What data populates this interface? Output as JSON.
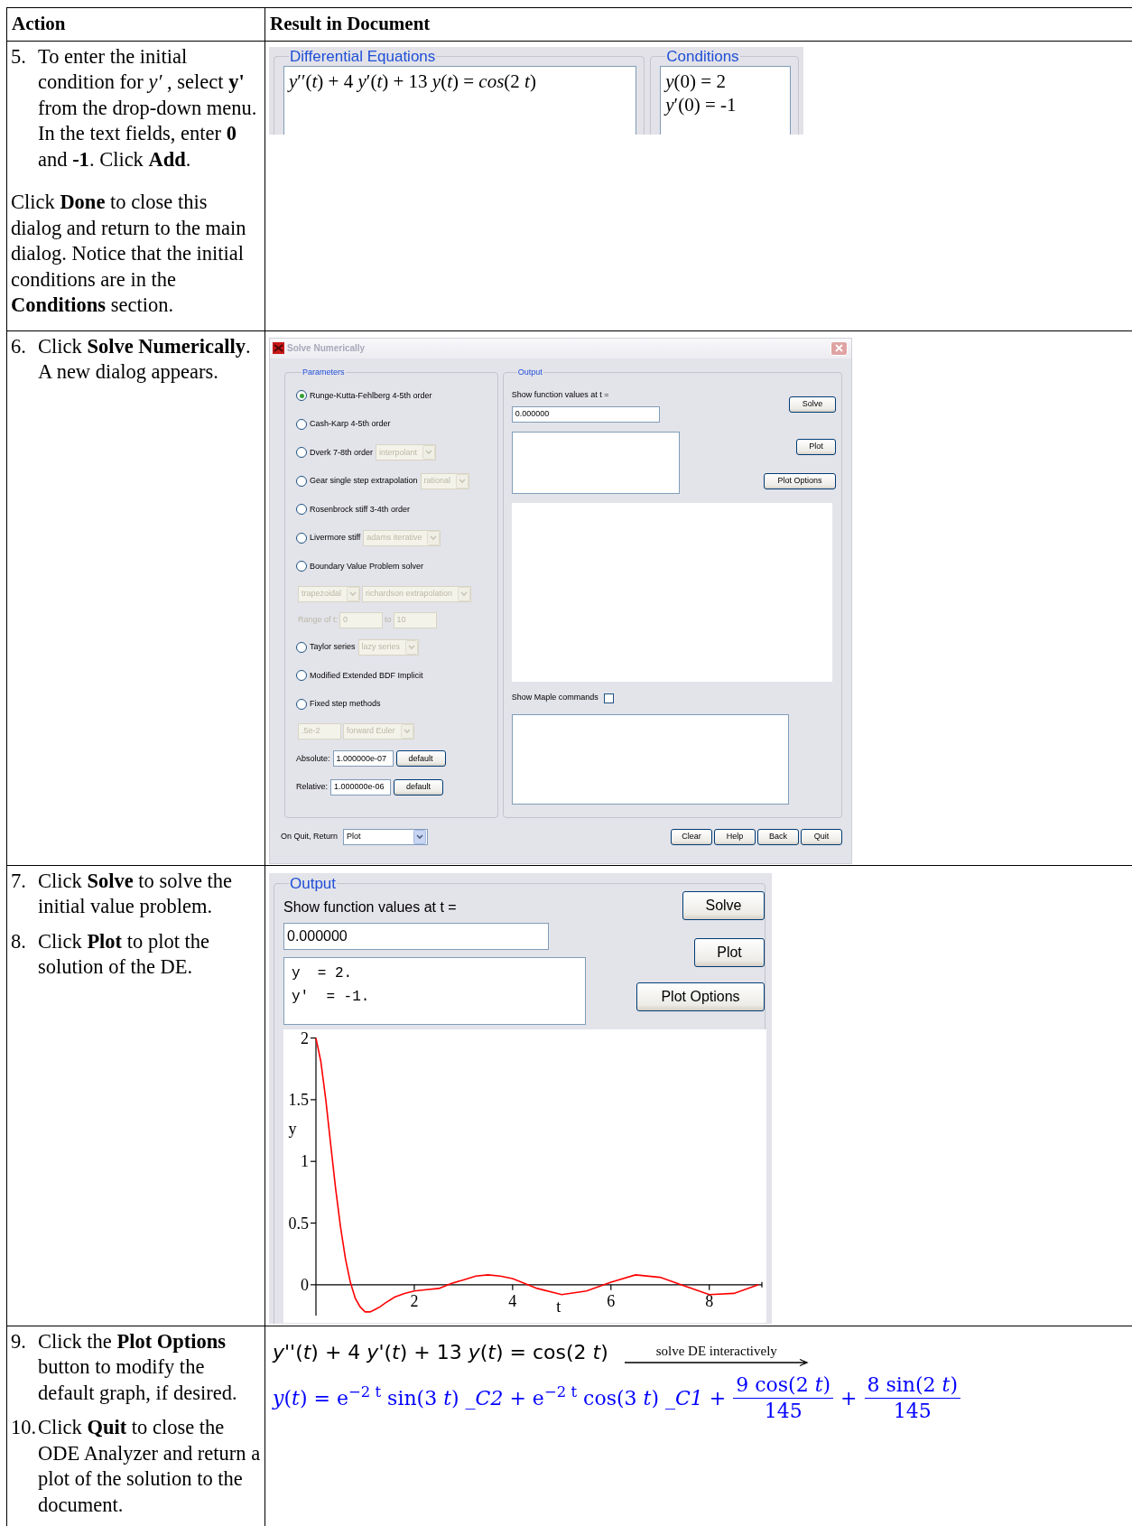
{
  "table": {
    "columns": [
      "Action",
      "Result in Document"
    ],
    "rows": [
      {
        "steps": [
          {
            "number": "5.",
            "text": "To enter the initial condition for *y′* , select **y'** from the drop-down menu. In the text fields, enter **0** and **-1**. Click **Add**."
          },
          {
            "text": "Click **Done** to close this dialog and return to the main dialog. Notice that the initial conditions are in the **Conditions** section."
          }
        ],
        "result": {
          "kind": "conditions",
          "groups": [
            {
              "title": "Differential Equations",
              "lines": [
                "*y*′′(*t*) + 4 *y*′(*t*) + 13 *y*(*t*) = *cos*(2 *t*)"
              ]
            },
            {
              "title": "Conditions",
              "lines": [
                "*y*(0) = 2",
                "*y*′(0) = -1"
              ]
            }
          ]
        }
      },
      {
        "steps": [
          {
            "number": "6.",
            "text": "Click **Solve Numerically**. A new dialog appears."
          }
        ],
        "result": {
          "kind": "dialog",
          "title": "Solve Numerically",
          "parameters": {
            "title": "Parameters",
            "methods": [
              {
                "label": "Runge-Kutta-Fehlberg 4-5th order",
                "selected": true
              },
              {
                "label": "Cash-Karp 4-5th order",
                "selected": false
              },
              {
                "label": "Dverk 7-8th order",
                "selected": false,
                "dropdown": {
                  "value": "interpolant",
                  "disabled": true
                }
              },
              {
                "label": "Gear single step extrapolation",
                "selected": false,
                "dropdown": {
                  "value": "rational",
                  "disabled": true
                }
              },
              {
                "label": "Rosenbrock stiff 3-4th order",
                "selected": false
              },
              {
                "label": "Livermore stiff",
                "selected": false,
                "dropdown": {
                  "value": "adams iterative",
                  "disabled": true
                }
              },
              {
                "label": "Boundary Value Problem solver",
                "selected": false,
                "options": [
                  [
                    {
                      "kind": "dropdown",
                      "value": "trapezoidal",
                      "disabled": true
                    },
                    {
                      "kind": "dropdown",
                      "value": "richardson extrapolation",
                      "disabled": true
                    }
                  ],
                  [
                    {
                      "kind": "label",
                      "text": "Range of t:",
                      "disabled": true
                    },
                    {
                      "kind": "field",
                      "value": "0",
                      "disabled": true
                    },
                    {
                      "kind": "label",
                      "text": "to",
                      "disabled": true
                    },
                    {
                      "kind": "field",
                      "value": "10",
                      "disabled": true
                    }
                  ]
                ]
              },
              {
                "label": "Taylor series",
                "selected": false,
                "dropdown": {
                  "value": "lazy series",
                  "disabled": true
                }
              },
              {
                "label": "Modified Extended BDF Implicit",
                "selected": false
              },
              {
                "label": "Fixed step methods",
                "selected": false,
                "options": [
                  [
                    {
                      "kind": "field",
                      "value": ".5e-2",
                      "disabled": true
                    },
                    {
                      "kind": "dropdown",
                      "value": "forward Euler",
                      "disabled": true
                    }
                  ]
                ]
              }
            ],
            "tolerances": [
              {
                "label": "Absolute:",
                "value": "1.000000e-07",
                "button": "default"
              },
              {
                "label": "Relative:",
                "value": "1.000000e-06",
                "button": "default"
              }
            ]
          },
          "output": {
            "title": "Output",
            "prompt": "Show function values at t =",
            "value": "0.000000",
            "buttons": [
              "Solve",
              "Plot",
              "Plot Options"
            ],
            "show_commands": {
              "label": "Show Maple commands",
              "checked": false
            }
          },
          "footer": {
            "label": "On Quit, Return",
            "dropdown": {
              "value": "Plot"
            },
            "buttons": [
              "Clear",
              "Help",
              "Back",
              "Quit"
            ]
          }
        }
      },
      {
        "steps": [
          {
            "number": "7.",
            "text": "Click **Solve** to solve the initial value problem."
          },
          {
            "number": "8.",
            "text": "Click **Plot** to plot the solution of the DE."
          }
        ],
        "result": {
          "kind": "output_panel",
          "output": {
            "title": "Output",
            "prompt": "Show function values at t =",
            "value": "0.000000",
            "results": [
              "y  = 2.",
              "y'  = -1."
            ],
            "buttons": [
              "Solve",
              "Plot",
              "Plot Options"
            ],
            "chart_data": {
              "type": "line",
              "xlabel": "t",
              "ylabel": "y",
              "xlim": [
                0,
                9.07
              ],
              "ylim": [
                -0.25,
                2.07
              ],
              "xticks": [
                2,
                4,
                6,
                8
              ],
              "yticks": [
                0,
                0.5,
                1,
                1.5,
                2
              ],
              "x": [
                0,
                0.1,
                0.2,
                0.3,
                0.4,
                0.5,
                0.6,
                0.7,
                0.8,
                0.9,
                1,
                1.1,
                1.2,
                1.3,
                1.4,
                1.6,
                1.8,
                2,
                2.25,
                2.5,
                2.75,
                3,
                3.25,
                3.5,
                3.75,
                4,
                4.5,
                5,
                5.5,
                6,
                6.5,
                7,
                7.5,
                8,
                8.5,
                9
              ],
              "series": [
                {
                  "color": "#ff0000",
                  "values": [
                    2,
                    1.81,
                    1.5,
                    1.14,
                    0.78,
                    0.47,
                    0.21,
                    0.02,
                    -0.11,
                    -0.18,
                    -0.22,
                    -0.22,
                    -0.2,
                    -0.18,
                    -0.15,
                    -0.1,
                    -0.07,
                    -0.05,
                    -0.04,
                    -0.03,
                    0.01,
                    0.04,
                    0.07,
                    0.08,
                    0.07,
                    0.05,
                    -0.03,
                    -0.08,
                    -0.05,
                    0.02,
                    0.08,
                    0.06,
                    -0.01,
                    -0.08,
                    -0.07,
                    0
                  ]
                }
              ]
            }
          }
        }
      },
      {
        "steps": [
          {
            "number": "9.",
            "text": "Click the **Plot Options** button to modify the default graph, if desired."
          },
          {
            "number": "10.",
            "text": "Click **Quit** to close the ODE Analyzer and return a plot of the solution to the document."
          }
        ],
        "result": {
          "kind": "math",
          "equation": "*y*''(*t*) + 4 *y*'(*t*) + 13 *y*(*t*) = cos(2 *t*)",
          "arrow_label": "solve DE interactively",
          "solution": [
            {
              "kind": "text",
              "text": "*y*(*t*) = e$^{−2 t}$ sin(3 *t*) *_C2* + e$^{−2 t}$ cos(3 *t*) *_C1* +"
            },
            {
              "kind": "fraction",
              "numerator": "9 cos(2 *t*)",
              "denominator": "145"
            },
            {
              "kind": "text",
              "text": "+"
            },
            {
              "kind": "fraction",
              "numerator": "8 sin(2 *t*)",
              "denominator": "145"
            }
          ]
        }
      }
    ]
  }
}
